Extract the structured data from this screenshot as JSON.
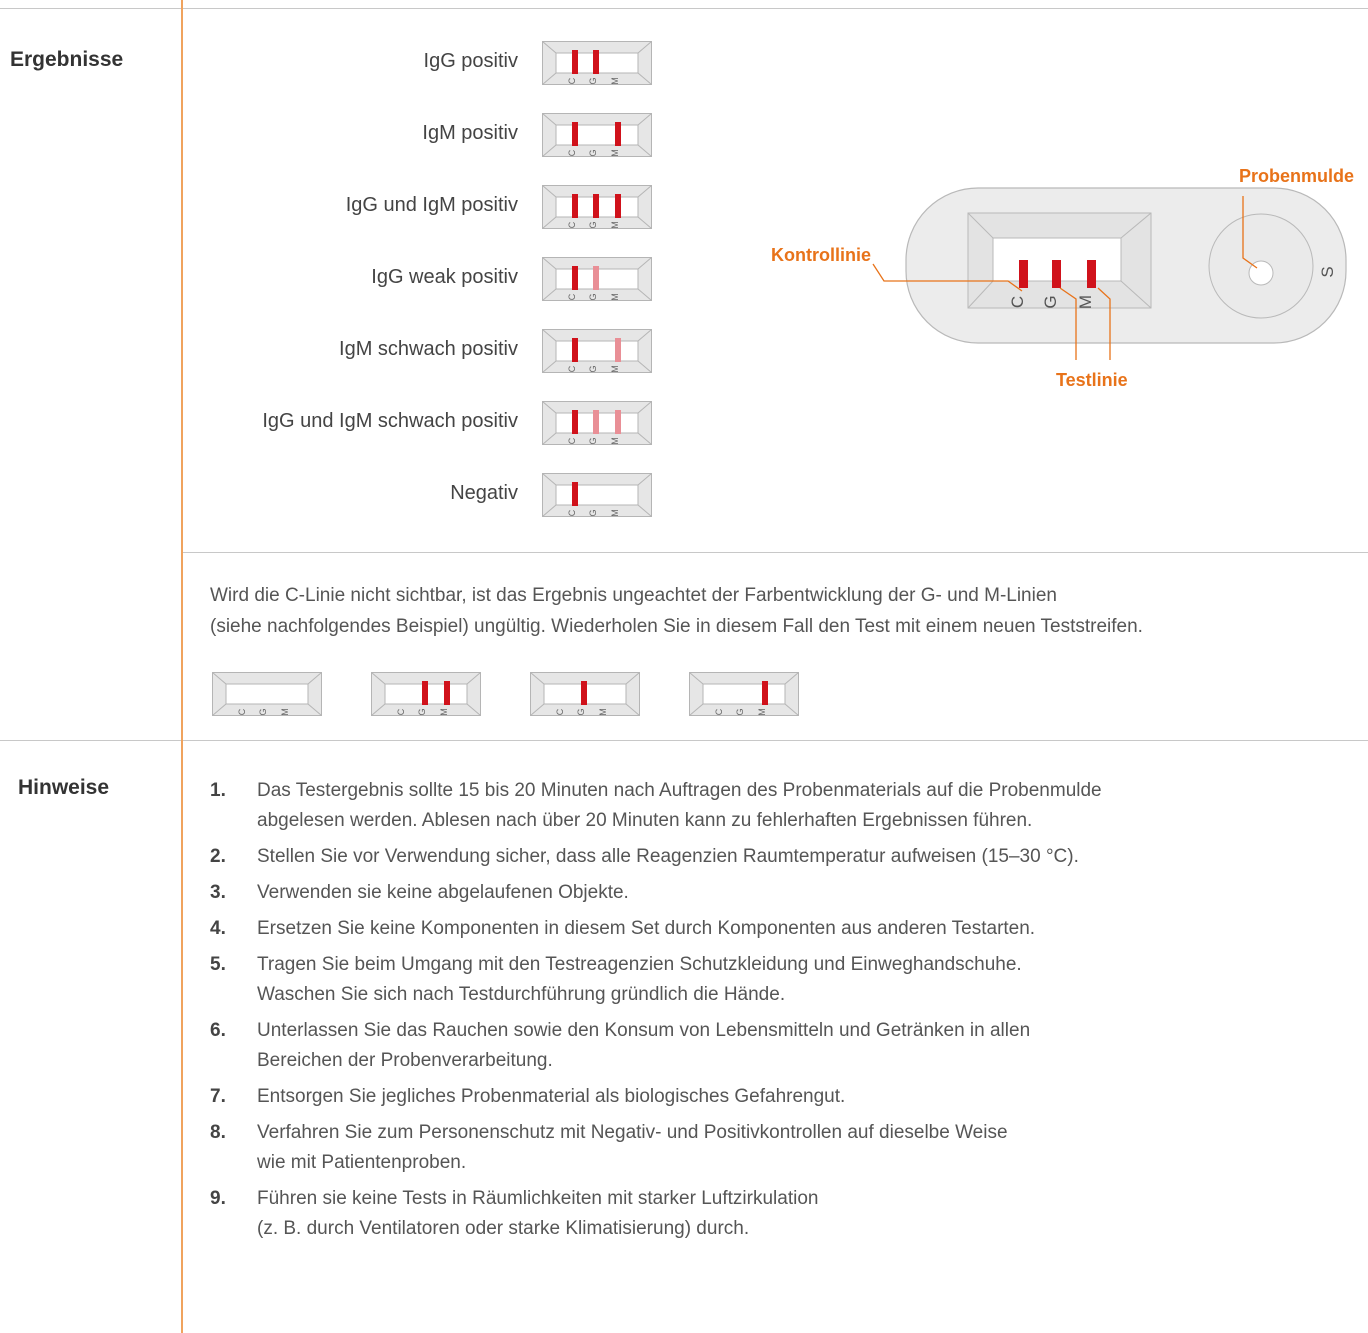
{
  "results": {
    "title": "Ergebnisse",
    "rows": [
      {
        "label": "IgG positiv",
        "c": "strong",
        "g": "strong",
        "m": "none"
      },
      {
        "label": "IgM positiv",
        "c": "strong",
        "g": "none",
        "m": "strong"
      },
      {
        "label": "IgG und IgM positiv",
        "c": "strong",
        "g": "strong",
        "m": "strong"
      },
      {
        "label": "IgG weak positiv",
        "c": "strong",
        "g": "weak",
        "m": "none"
      },
      {
        "label": "IgM schwach positiv",
        "c": "strong",
        "g": "none",
        "m": "weak"
      },
      {
        "label": "IgG und IgM schwach positiv",
        "c": "strong",
        "g": "weak",
        "m": "weak"
      },
      {
        "label": "Negativ",
        "c": "strong",
        "g": "none",
        "m": "none"
      }
    ]
  },
  "diagram": {
    "control_line": "Kontrollinie",
    "sample_well": "Probenmulde",
    "test_line": "Testlinie",
    "letters": {
      "c": "C",
      "g": "G",
      "m": "M",
      "s": "S"
    }
  },
  "invalid": {
    "line1": "Wird die C-Linie nicht sichtbar, ist das Ergebnis ungeachtet der Farbentwicklung der G- und M-Linien",
    "line2": "(siehe nachfolgendes Beispiel) ungültig. Wiederholen Sie in diesem Fall den Test mit einem neuen Teststreifen.",
    "examples": [
      {
        "c": "none",
        "g": "none",
        "m": "none"
      },
      {
        "c": "none",
        "g": "strong",
        "m": "strong"
      },
      {
        "c": "none",
        "g": "strong",
        "m": "none"
      },
      {
        "c": "none",
        "g": "none",
        "m": "strong"
      }
    ]
  },
  "notes": {
    "title": "Hinweise",
    "items": [
      {
        "num": "1.",
        "lines": [
          "Das Testergebnis sollte 15 bis 20 Minuten nach Auftragen des Probenmaterials auf die Probenmulde",
          "abgelesen werden. Ablesen nach über 20 Minuten kann zu fehlerhaften Ergebnissen führen."
        ]
      },
      {
        "num": "2.",
        "lines": [
          "Stellen Sie vor Verwendung sicher, dass alle Reagenzien Raumtemperatur aufweisen (15–30 °C)."
        ]
      },
      {
        "num": "3.",
        "lines": [
          "Verwenden sie keine abgelaufenen Objekte."
        ]
      },
      {
        "num": "4.",
        "lines": [
          "Ersetzen Sie keine Komponenten in diesem Set durch Komponenten aus anderen Testarten."
        ]
      },
      {
        "num": "5.",
        "lines": [
          "Tragen Sie beim Umgang mit den Testreagenzien Schutzkleidung und Einweghandschuhe.",
          "Waschen Sie sich nach Testdurchführung gründlich die Hände."
        ]
      },
      {
        "num": "6.",
        "lines": [
          "Unterlassen Sie das Rauchen sowie den Konsum von Lebensmitteln und Getränken in allen",
          "Bereichen der Probenverarbeitung."
        ]
      },
      {
        "num": "7.",
        "lines": [
          "Entsorgen Sie jegliches Probenmaterial als biologisches Gefahrengut."
        ]
      },
      {
        "num": "8.",
        "lines": [
          "Verfahren Sie zum Personenschutz mit Negativ- und Positivkontrollen auf dieselbe Weise",
          "wie mit Patientenproben."
        ]
      },
      {
        "num": "9.",
        "lines": [
          "Führen sie keine Tests in Räumlichkeiten mit starker Luftzirkulation",
          "(z. B. durch Ventilatoren oder starke Klimatisierung) durch."
        ]
      }
    ]
  },
  "colors": {
    "accent": "#e8731a",
    "strong_line": "#d0121b",
    "weak_line": "#e98f96",
    "rule": "#f0a35e"
  }
}
